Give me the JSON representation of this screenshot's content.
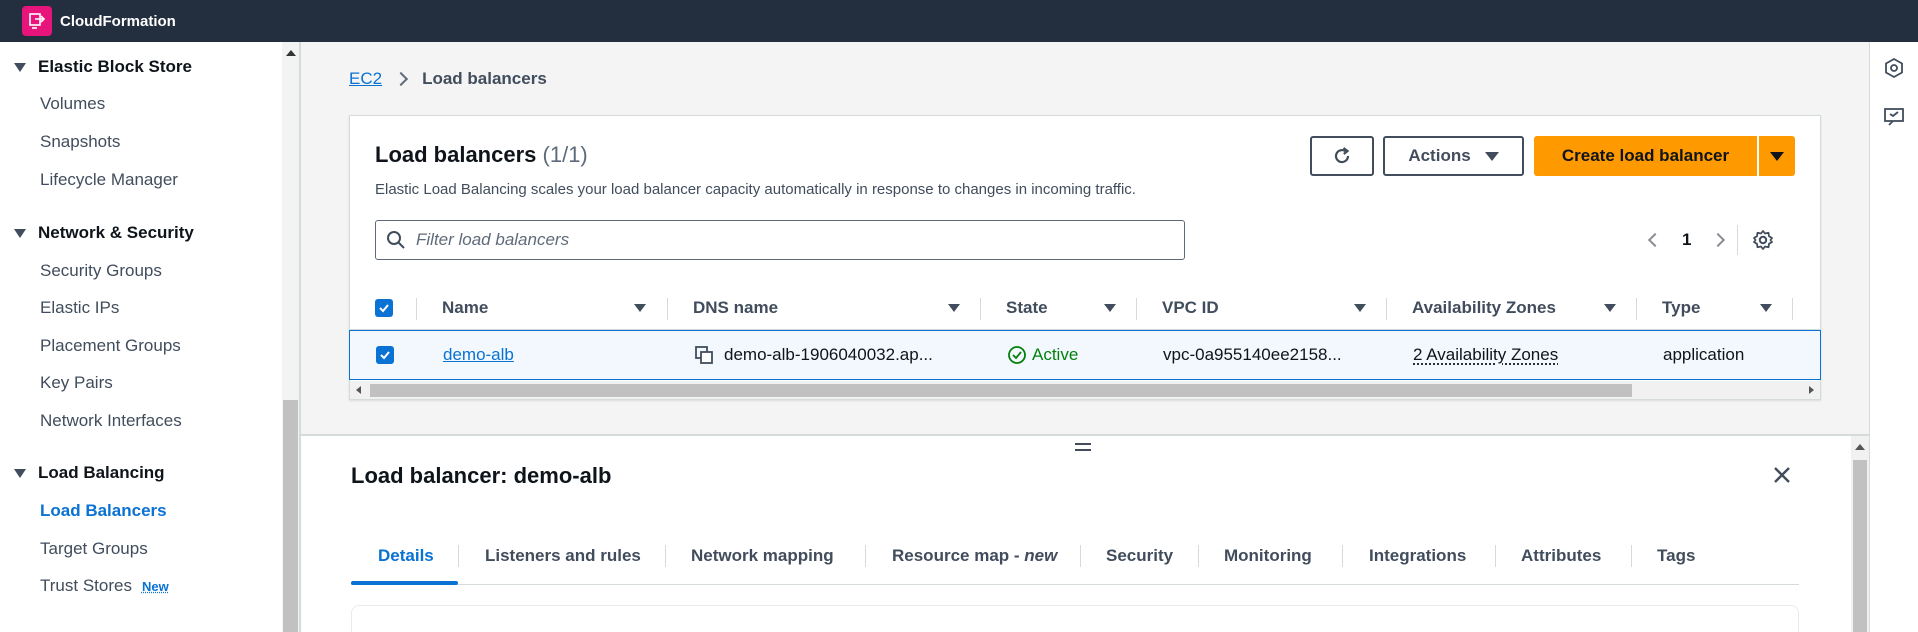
{
  "app": {
    "title": "CloudFormation",
    "brand_color": "#e7157b"
  },
  "sidebar": {
    "sections": [
      {
        "label": "Elastic Block Store",
        "items": [
          "Volumes",
          "Snapshots",
          "Lifecycle Manager"
        ]
      },
      {
        "label": "Network & Security",
        "items": [
          "Security Groups",
          "Elastic IPs",
          "Placement Groups",
          "Key Pairs",
          "Network Interfaces"
        ]
      },
      {
        "label": "Load Balancing",
        "items": [
          "Load Balancers",
          "Target Groups",
          "Trust Stores"
        ]
      }
    ],
    "active_item": "Load Balancers",
    "new_badge": "New"
  },
  "breadcrumb": {
    "root": "EC2",
    "current": "Load balancers"
  },
  "panel": {
    "title": "Load balancers",
    "count": "(1/1)",
    "description": "Elastic Load Balancing scales your load balancer capacity automatically in response to changes in incoming traffic.",
    "actions_label": "Actions",
    "create_label": "Create load balancer",
    "filter_placeholder": "Filter load balancers",
    "page": "1"
  },
  "table": {
    "columns": [
      "Name",
      "DNS name",
      "State",
      "VPC ID",
      "Availability Zones",
      "Type"
    ],
    "row": {
      "name": "demo-alb",
      "dns": "demo-alb-1906040032.ap...",
      "state": "Active",
      "vpc": "vpc-0a955140ee2158...",
      "az": "2 Availability Zones",
      "type": "application"
    }
  },
  "details": {
    "title": "Load balancer: demo-alb",
    "tabs": [
      "Details",
      "Listeners and rules",
      "Network mapping",
      "Resource map - ",
      "Security",
      "Monitoring",
      "Integrations",
      "Attributes",
      "Tags"
    ],
    "resource_map_suffix": "new"
  },
  "colors": {
    "accent": "#0972d3",
    "primary_button": "#ff9900",
    "success": "#037f0c",
    "topbar": "#232f3e"
  }
}
